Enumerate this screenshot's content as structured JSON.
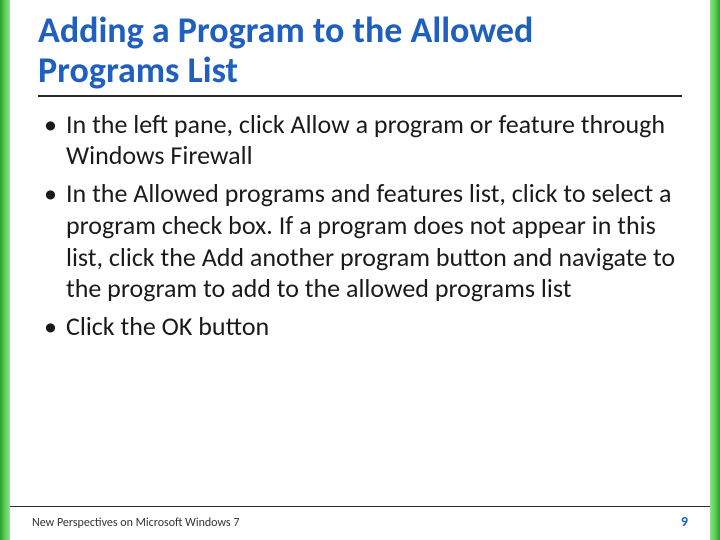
{
  "title": "Adding a Program to the Allowed Programs List",
  "bullets": [
    "In the left pane, click Allow a program or feature through Windows Firewall",
    "In the Allowed programs and features list, click to select a program check box. If a program does not appear in this list, click the Add another program button and navigate to the program to add to the allowed programs list",
    "Click the OK button"
  ],
  "footer": {
    "left": "New Perspectives on Microsoft Windows 7",
    "page": "9"
  },
  "colors": {
    "title": "#1f5fbf",
    "edge": "#2e9b2e"
  }
}
